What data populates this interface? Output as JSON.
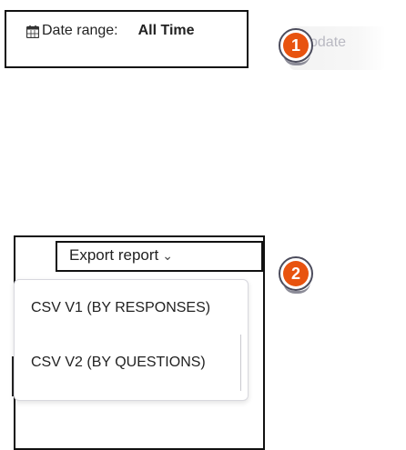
{
  "date_filter": {
    "label": "Date range:",
    "value": "All Time",
    "icon": "calendar-icon"
  },
  "update_button": {
    "label": "pdate"
  },
  "steps": [
    {
      "number": "1"
    },
    {
      "number": "2"
    }
  ],
  "export": {
    "button_label": "Export report",
    "chevron": "⌄",
    "options": [
      "CSV V1 (BY RESPONSES)",
      "CSV V2 (BY QUESTIONS)"
    ]
  },
  "colors": {
    "badge_fill": "#e8530f",
    "border": "#111111"
  }
}
